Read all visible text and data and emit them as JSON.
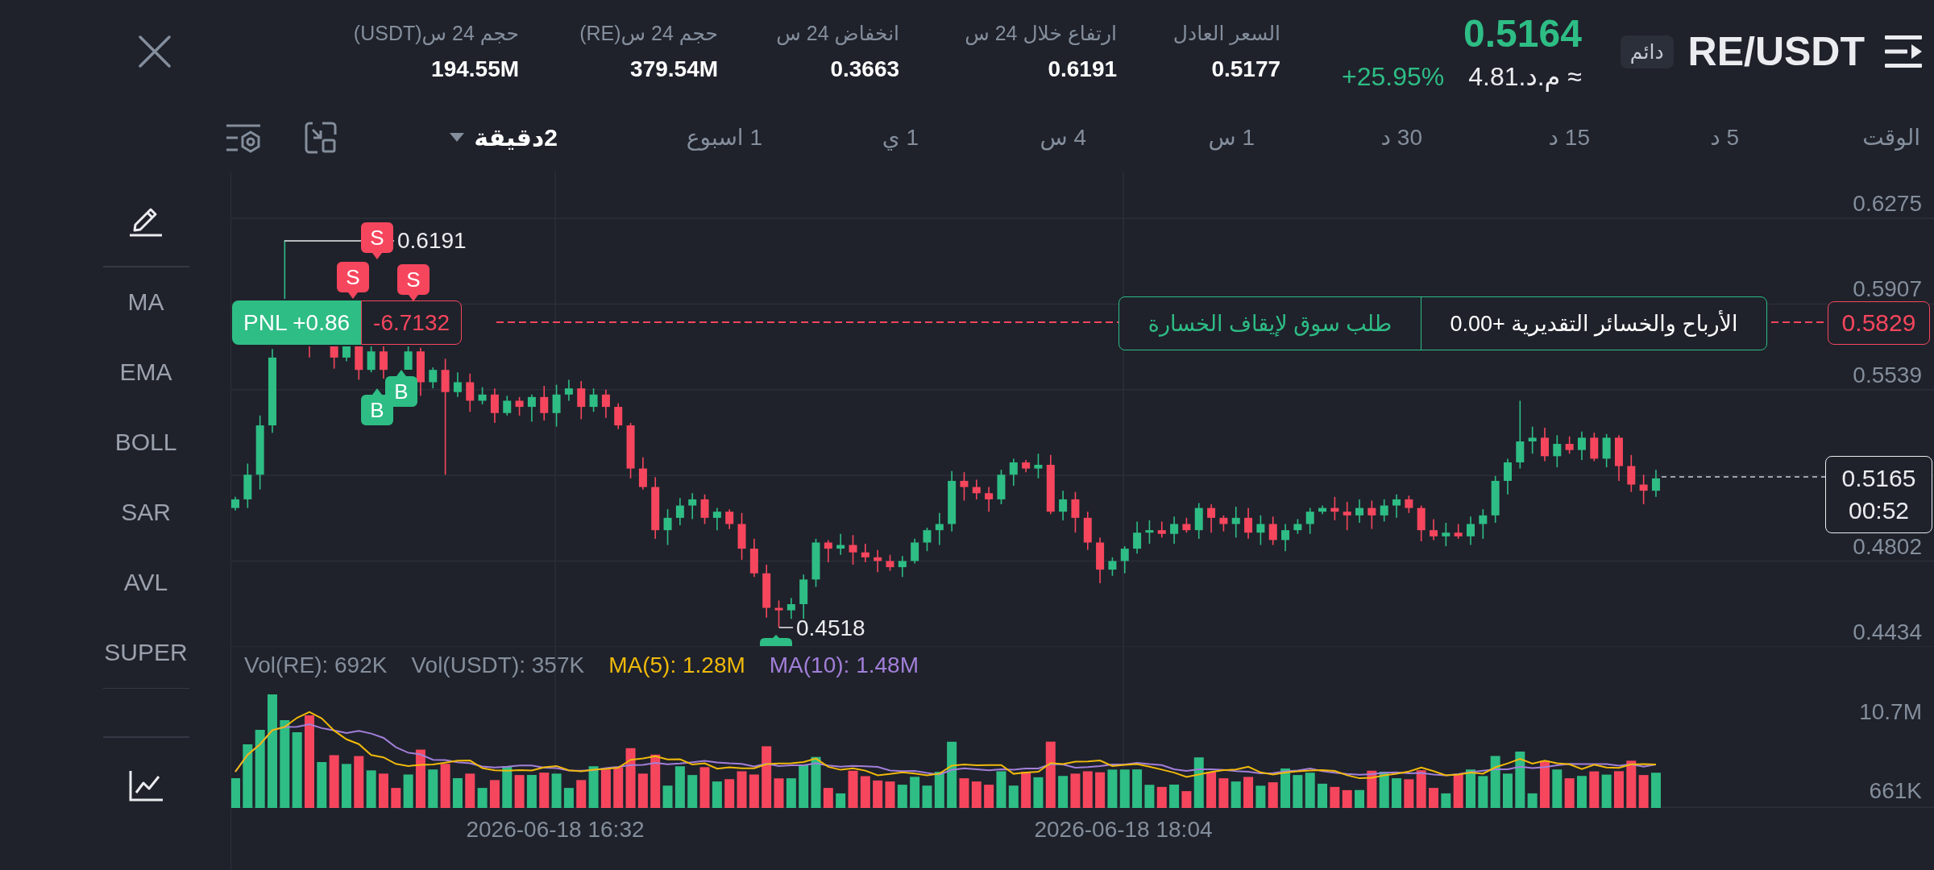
{
  "header": {
    "symbol": "RE/USDT",
    "badge": "دائم",
    "last_price": "0.5164",
    "fiat_price": "≈ م.د.4.81",
    "change": "+25.95%",
    "stats": [
      {
        "label": "السعر العادل",
        "value": "0.5177"
      },
      {
        "label": "ارتفاع خلال 24 س",
        "value": "0.6191"
      },
      {
        "label": "انخفاض 24 س",
        "value": "0.3663"
      },
      {
        "label": "حجم 24 س(RE)",
        "value": "379.54M"
      },
      {
        "label": "حجم 24 س(USDT)",
        "value": "194.55M"
      }
    ]
  },
  "timeframes": {
    "label": "الوقت",
    "items": [
      {
        "label": "5 د",
        "kind": "tab",
        "selected": false
      },
      {
        "label": "15 د",
        "kind": "tab",
        "selected": false
      },
      {
        "label": "30 د",
        "kind": "tab",
        "selected": false
      },
      {
        "label": "1 س",
        "kind": "tab",
        "selected": false
      },
      {
        "label": "4 س",
        "kind": "tab",
        "selected": false
      },
      {
        "label": "1 ي",
        "kind": "tab",
        "selected": false
      },
      {
        "label": "1 اسبوع",
        "kind": "tab",
        "selected": false
      },
      {
        "label": "2دقيقة",
        "kind": "dropdown",
        "selected": true
      }
    ]
  },
  "indicators": [
    "MA",
    "EMA",
    "BOLL",
    "SAR",
    "AVL",
    "SUPER"
  ],
  "chart": {
    "price_ticks": [
      "0.6275",
      "0.5907",
      "0.5539",
      "0.4802",
      "0.4434"
    ],
    "high_label": "0.6191",
    "low_label": "0.4518",
    "markers": [
      {
        "kind": "sell",
        "label": "S"
      },
      {
        "kind": "sell",
        "label": "S"
      },
      {
        "kind": "sell",
        "label": "S"
      },
      {
        "kind": "buy",
        "label": "B"
      },
      {
        "kind": "buy",
        "label": "B"
      }
    ],
    "position": {
      "pnl": "PNL +0.86",
      "size": "-6.7132"
    },
    "stop_order": {
      "label": "طلب سوق لإيقاف الخسارة",
      "estimate": "الأرباح والخسائر التقديرية +0.00",
      "price": "0.5829"
    },
    "last_price": {
      "price": "0.5165",
      "countdown": "00:52"
    }
  },
  "volume": {
    "legend": [
      {
        "text": "MA(10): 1.48M",
        "color": "#a27fd9"
      },
      {
        "text": "MA(5): 1.28M",
        "color": "#f0b90b"
      },
      {
        "text": "Vol(USDT): 357K",
        "color": "#848e9c"
      },
      {
        "text": "Vol(RE): 692K",
        "color": "#848e9c"
      }
    ],
    "ticks": [
      "10.7M",
      "661K"
    ]
  },
  "time_axis": [
    "2026-06-18 18:04",
    "2026-06-18 16:32"
  ]
}
